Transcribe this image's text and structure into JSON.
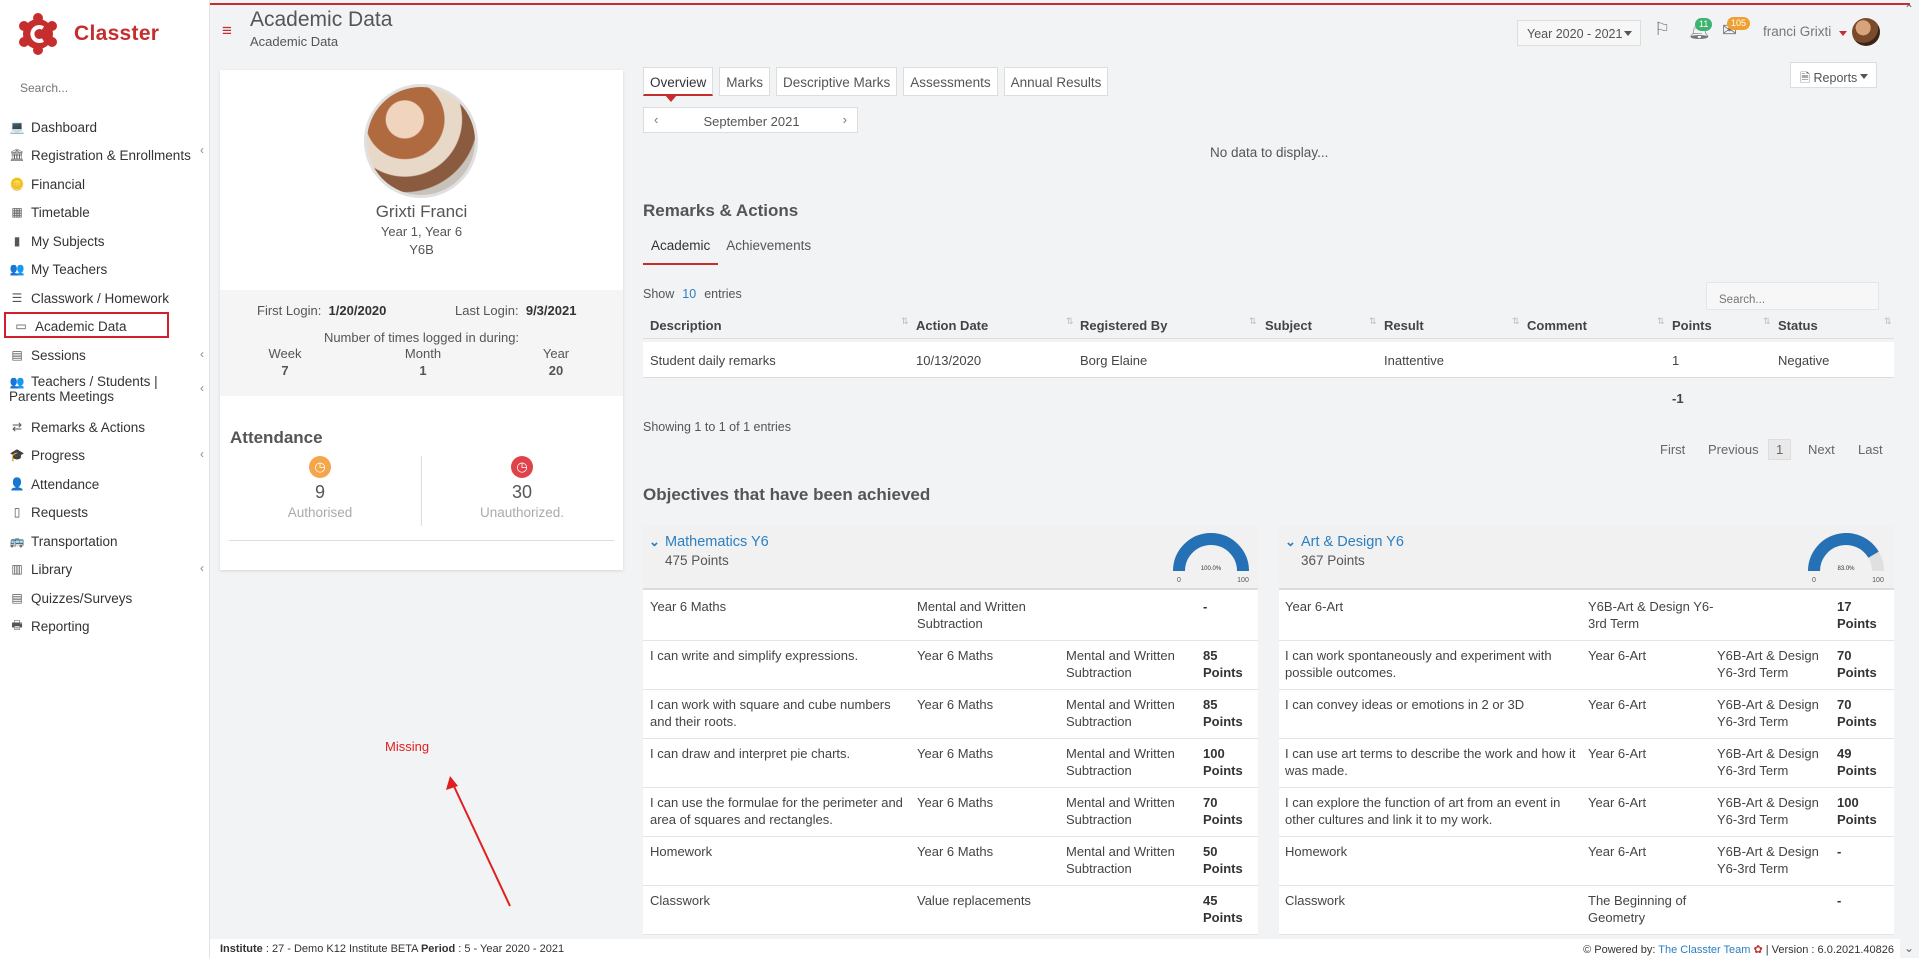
{
  "app": {
    "name": "Classter",
    "search_placeholder": "Search...",
    "brand_color": "#c62d2d"
  },
  "sidebar": {
    "items": [
      {
        "label": "Dashboard",
        "icon": "laptop-icon",
        "chevron": false
      },
      {
        "label": "Registration & Enrollments",
        "icon": "institution-icon",
        "chevron": true
      },
      {
        "label": "Financial",
        "icon": "coins-icon",
        "chevron": false
      },
      {
        "label": "Timetable",
        "icon": "calendar-icon",
        "chevron": false
      },
      {
        "label": "My Subjects",
        "icon": "book-icon",
        "chevron": false
      },
      {
        "label": "My Teachers",
        "icon": "users-icon",
        "chevron": false
      },
      {
        "label": "Classwork / Homework",
        "icon": "list-icon",
        "chevron": false
      },
      {
        "label": "Academic Data",
        "icon": "chart-card-icon",
        "chevron": false,
        "active": true
      },
      {
        "label": "Sessions",
        "icon": "sessions-icon",
        "chevron": true
      },
      {
        "label": "Teachers / Students |",
        "label2": "Parents Meetings",
        "icon": "meeting-icon",
        "chevron": true
      },
      {
        "label": "Remarks & Actions",
        "icon": "shuffle-icon",
        "chevron": false
      },
      {
        "label": "Progress",
        "icon": "graduation-cap-icon",
        "chevron": true
      },
      {
        "label": "Attendance",
        "icon": "user-clock-icon",
        "chevron": false
      },
      {
        "label": "Requests",
        "icon": "file-icon",
        "chevron": false
      },
      {
        "label": "Transportation",
        "icon": "bus-icon",
        "chevron": false
      },
      {
        "label": "Library",
        "icon": "library-icon",
        "chevron": true
      },
      {
        "label": "Quizzes/Surveys",
        "icon": "quiz-icon",
        "chevron": false
      },
      {
        "label": "Reporting",
        "icon": "printer-icon",
        "chevron": false
      }
    ]
  },
  "header": {
    "title": "Academic Data",
    "subtitle": "Academic Data",
    "year": "Year 2020 - 2021",
    "notifications_count": "11",
    "messages_count": "105",
    "user_name": "franci Grixti"
  },
  "profile": {
    "name": "Grixti Franci",
    "year": "Year 1, Year 6",
    "class": "Y6B",
    "first_login_label": "First Login:",
    "first_login": "1/20/2020",
    "last_login_label": "Last Login:",
    "last_login": "9/3/2021",
    "logged_label": "Number of times logged in during:",
    "week_label": "Week",
    "week": "7",
    "month_label": "Month",
    "month": "1",
    "year_label": "Year",
    "year_count": "20",
    "attendance_title": "Attendance",
    "authorised": "9",
    "authorised_label": "Authorised",
    "unauthorized": "30",
    "unauthorized_label": "Unauthorized."
  },
  "annotation": {
    "text": "Missing",
    "color": "#e02020"
  },
  "main": {
    "tabs": [
      "Overview",
      "Marks",
      "Descriptive Marks",
      "Assessments",
      "Annual Results"
    ],
    "reports_label": "Reports",
    "month": "September 2021",
    "no_data": "No data to display...",
    "remarks_title": "Remarks & Actions",
    "subtabs": [
      "Academic",
      "Achievements"
    ],
    "show_label": "Show",
    "show_count": "10",
    "entries_label": "entries",
    "table_search_placeholder": "Search...",
    "columns": [
      "Description",
      "Action Date",
      "Registered By",
      "Subject",
      "Result",
      "Comment",
      "Points",
      "Status"
    ],
    "row": {
      "description": "Student daily remarks",
      "date": "10/13/2020",
      "registered_by": "Borg Elaine",
      "subject": "",
      "result": "Inattentive",
      "comment": "",
      "points": "1",
      "status": "Negative"
    },
    "total_points": "-1",
    "showing": "Showing 1 to 1 of 1 entries",
    "pager": {
      "first": "First",
      "previous": "Previous",
      "current": "1",
      "next": "Next",
      "last": "Last"
    },
    "objectives_title": "Objectives that have been achieved"
  },
  "objectives": {
    "math": {
      "name": "Mathematics Y6",
      "points": "475 Points",
      "gauge_label": "100.0%",
      "gauge_min": "0",
      "gauge_max": "100",
      "gauge_value": 1.0,
      "rows": [
        [
          "Year 6 Maths",
          "Mental and Written Subtraction",
          "",
          "-"
        ],
        [
          "I can write and simplify expressions.",
          "Year 6 Maths",
          "Mental and Written Subtraction",
          "85 Points"
        ],
        [
          "I can work with square and cube numbers and their roots.",
          "Year 6 Maths",
          "Mental and Written Subtraction",
          "85 Points"
        ],
        [
          "I can draw and interpret pie charts.",
          "Year 6 Maths",
          "Mental and Written Subtraction",
          "100 Points"
        ],
        [
          "I can use the formulae for the perimeter and area of squares and rectangles.",
          "Year 6 Maths",
          "Mental and Written Subtraction",
          "70 Points"
        ],
        [
          "Homework",
          "Year 6 Maths",
          "Mental and Written Subtraction",
          "50 Points"
        ],
        [
          "Classwork",
          "Value replacements",
          "",
          "45 Points"
        ]
      ]
    },
    "art": {
      "name": "Art & Design Y6",
      "points": "367 Points",
      "gauge_label": "83.0%",
      "gauge_min": "0",
      "gauge_max": "100",
      "gauge_value": 0.83,
      "rows": [
        [
          "Year 6-Art",
          "Y6B-Art & Design Y6-3rd Term",
          "",
          "17 Points"
        ],
        [
          "I can work spontaneously and experiment with possible outcomes.",
          "Year 6-Art",
          "Y6B-Art & Design Y6-3rd Term",
          "70 Points"
        ],
        [
          "I can convey ideas or emotions in 2 or 3D",
          "Year 6-Art",
          "Y6B-Art & Design Y6-3rd Term",
          "70 Points"
        ],
        [
          "I can use art terms to describe the work and how it was made.",
          "Year 6-Art",
          "Y6B-Art & Design Y6-3rd Term",
          "49 Points"
        ],
        [
          "I can explore the function of art from an event in other cultures and link it to my work.",
          "Year 6-Art",
          "Y6B-Art & Design Y6-3rd Term",
          "100 Points"
        ],
        [
          "Homework",
          "Year 6-Art",
          "Y6B-Art & Design Y6-3rd Term",
          "-"
        ],
        [
          "Classwork",
          "The Beginning of Geometry",
          "",
          "-"
        ]
      ]
    }
  },
  "footer": {
    "institute_label": "Institute",
    "institute": ": 27 - Demo K12 Institute BETA",
    "period_label": "Period",
    "period": ": 5 - Year 2020 - 2021",
    "powered_by": "Powered by:",
    "team": "The Classter Team",
    "version": "| Version : 6.0.2021.40826"
  }
}
